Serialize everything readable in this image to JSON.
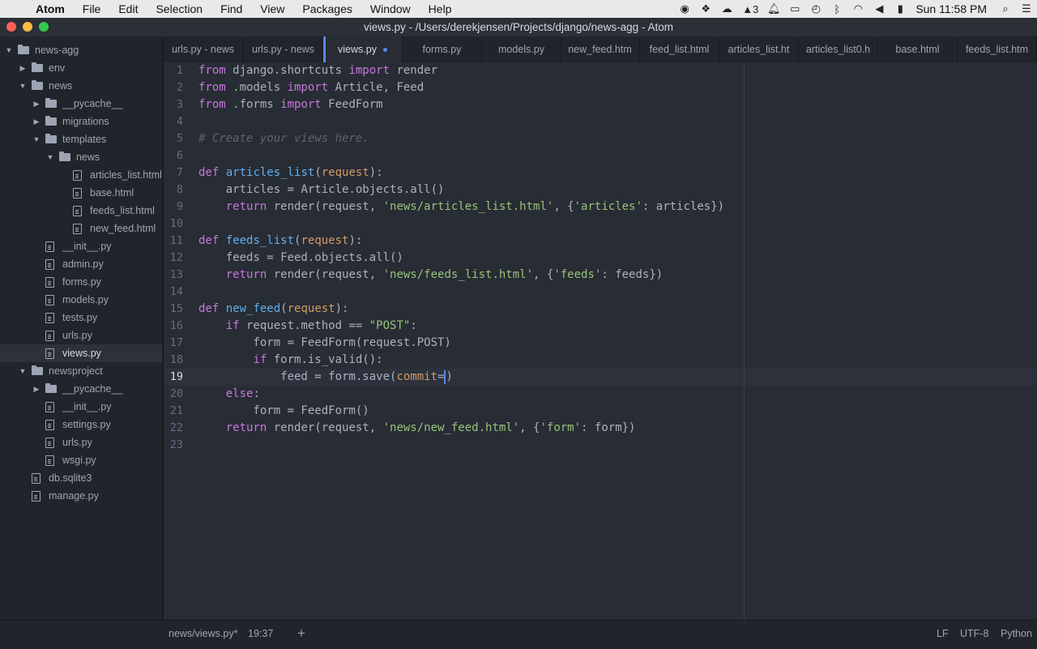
{
  "menubar": {
    "apple": "",
    "app_name": "Atom",
    "menus": [
      "File",
      "Edit",
      "Selection",
      "Find",
      "View",
      "Packages",
      "Window",
      "Help"
    ],
    "status_icons": [
      "camera-record-icon",
      "dropbox-icon",
      "cloud-icon",
      "adobe-icon",
      "notification-bell-icon",
      "battery-meter-icon",
      "time-machine-icon",
      "bluetooth-icon",
      "wifi-icon",
      "volume-icon",
      "battery-icon",
      "search-icon",
      "list-icon"
    ],
    "adobe_count": "3",
    "clock": "Sun 11:58 PM"
  },
  "window": {
    "title": "views.py - /Users/derekjensen/Projects/django/news-agg - Atom",
    "traffic_colors": [
      "#fc605b",
      "#fdbc40",
      "#34c84a"
    ]
  },
  "tree": {
    "root": "news-agg",
    "items": [
      {
        "label": "env",
        "type": "dir",
        "depth": 1,
        "expanded": false
      },
      {
        "label": "news",
        "type": "dir",
        "depth": 1,
        "expanded": true
      },
      {
        "label": "__pycache__",
        "type": "dir",
        "depth": 2,
        "expanded": false
      },
      {
        "label": "migrations",
        "type": "dir",
        "depth": 2,
        "expanded": false
      },
      {
        "label": "templates",
        "type": "dir",
        "depth": 2,
        "expanded": true
      },
      {
        "label": "news",
        "type": "dir",
        "depth": 3,
        "expanded": true
      },
      {
        "label": "articles_list.html",
        "type": "file",
        "depth": 4
      },
      {
        "label": "base.html",
        "type": "file",
        "depth": 4
      },
      {
        "label": "feeds_list.html",
        "type": "file",
        "depth": 4
      },
      {
        "label": "new_feed.html",
        "type": "file",
        "depth": 4
      },
      {
        "label": "__init__.py",
        "type": "file",
        "depth": 2
      },
      {
        "label": "admin.py",
        "type": "file",
        "depth": 2
      },
      {
        "label": "forms.py",
        "type": "file",
        "depth": 2
      },
      {
        "label": "models.py",
        "type": "file",
        "depth": 2
      },
      {
        "label": "tests.py",
        "type": "file",
        "depth": 2
      },
      {
        "label": "urls.py",
        "type": "file",
        "depth": 2
      },
      {
        "label": "views.py",
        "type": "file",
        "depth": 2,
        "selected": true
      },
      {
        "label": "newsproject",
        "type": "dir",
        "depth": 1,
        "expanded": true
      },
      {
        "label": "__pycache__",
        "type": "dir",
        "depth": 2,
        "expanded": false
      },
      {
        "label": "__init__.py",
        "type": "file",
        "depth": 2
      },
      {
        "label": "settings.py",
        "type": "file",
        "depth": 2
      },
      {
        "label": "urls.py",
        "type": "file",
        "depth": 2
      },
      {
        "label": "wsgi.py",
        "type": "file",
        "depth": 2
      },
      {
        "label": "db.sqlite3",
        "type": "file",
        "depth": 1
      },
      {
        "label": "manage.py",
        "type": "file",
        "depth": 1
      }
    ]
  },
  "tabs": [
    {
      "label": "urls.py - news"
    },
    {
      "label": "urls.py - news"
    },
    {
      "label": "views.py",
      "active": true,
      "modified": true
    },
    {
      "label": "forms.py"
    },
    {
      "label": "models.py"
    },
    {
      "label": "new_feed.htm"
    },
    {
      "label": "feed_list.html"
    },
    {
      "label": "articles_list.ht"
    },
    {
      "label": "articles_list0.h"
    },
    {
      "label": "base.html"
    },
    {
      "label": "feeds_list.htm"
    }
  ],
  "editor": {
    "current_line": 19,
    "lines": [
      [
        [
          "k",
          "from"
        ],
        [
          "t",
          " django.shortcuts "
        ],
        [
          "k",
          "import"
        ],
        [
          "t",
          " render"
        ]
      ],
      [
        [
          "k",
          "from"
        ],
        [
          "t",
          " .models "
        ],
        [
          "k",
          "import"
        ],
        [
          "t",
          " Article, Feed"
        ]
      ],
      [
        [
          "k",
          "from"
        ],
        [
          "t",
          " .forms "
        ],
        [
          "k",
          "import"
        ],
        [
          "t",
          " FeedForm"
        ]
      ],
      [],
      [
        [
          "c",
          "# Create your views here."
        ]
      ],
      [],
      [
        [
          "k",
          "def"
        ],
        [
          "t",
          " "
        ],
        [
          "f",
          "articles_list"
        ],
        [
          "t",
          "("
        ],
        [
          "p",
          "request"
        ],
        [
          "t",
          "):"
        ]
      ],
      [
        [
          "t",
          "    articles = Article.objects.all()"
        ]
      ],
      [
        [
          "t",
          "    "
        ],
        [
          "k",
          "return"
        ],
        [
          "t",
          " render(request, "
        ],
        [
          "s",
          "'news/articles_list.html'"
        ],
        [
          "t",
          ", {"
        ],
        [
          "s",
          "'articles'"
        ],
        [
          "t",
          ": articles})"
        ]
      ],
      [],
      [
        [
          "k",
          "def"
        ],
        [
          "t",
          " "
        ],
        [
          "f",
          "feeds_list"
        ],
        [
          "t",
          "("
        ],
        [
          "p",
          "request"
        ],
        [
          "t",
          "):"
        ]
      ],
      [
        [
          "t",
          "    feeds = Feed.objects.all()"
        ]
      ],
      [
        [
          "t",
          "    "
        ],
        [
          "k",
          "return"
        ],
        [
          "t",
          " render(request, "
        ],
        [
          "s",
          "'news/feeds_list.html'"
        ],
        [
          "t",
          ", {"
        ],
        [
          "s",
          "'feeds'"
        ],
        [
          "t",
          ": feeds})"
        ]
      ],
      [],
      [
        [
          "k",
          "def"
        ],
        [
          "t",
          " "
        ],
        [
          "f",
          "new_feed"
        ],
        [
          "t",
          "("
        ],
        [
          "p",
          "request"
        ],
        [
          "t",
          "):"
        ]
      ],
      [
        [
          "t",
          "    "
        ],
        [
          "k",
          "if"
        ],
        [
          "t",
          " request.method == "
        ],
        [
          "s",
          "\"POST\""
        ],
        [
          "t",
          ":"
        ]
      ],
      [
        [
          "t",
          "        form = FeedForm(request.POST)"
        ]
      ],
      [
        [
          "t",
          "        "
        ],
        [
          "k",
          "if"
        ],
        [
          "t",
          " form.is_valid():"
        ]
      ],
      [
        [
          "t",
          "            feed = form.save("
        ],
        [
          "p",
          "commit"
        ],
        [
          "t",
          "="
        ],
        [
          "cur",
          ""
        ],
        [
          "t",
          ")"
        ]
      ],
      [
        [
          "t",
          "    "
        ],
        [
          "k",
          "else"
        ],
        [
          "t",
          ":"
        ]
      ],
      [
        [
          "t",
          "        form = FeedForm()"
        ]
      ],
      [
        [
          "t",
          "    "
        ],
        [
          "k",
          "return"
        ],
        [
          "t",
          " render(request, "
        ],
        [
          "s",
          "'news/new_feed.html'"
        ],
        [
          "t",
          ", {"
        ],
        [
          "s",
          "'form'"
        ],
        [
          "t",
          ": form})"
        ]
      ],
      []
    ]
  },
  "status": {
    "file": "news/views.py*",
    "position": "19:37",
    "add": "+",
    "line_ending": "LF",
    "encoding": "UTF-8",
    "grammar": "Python"
  }
}
